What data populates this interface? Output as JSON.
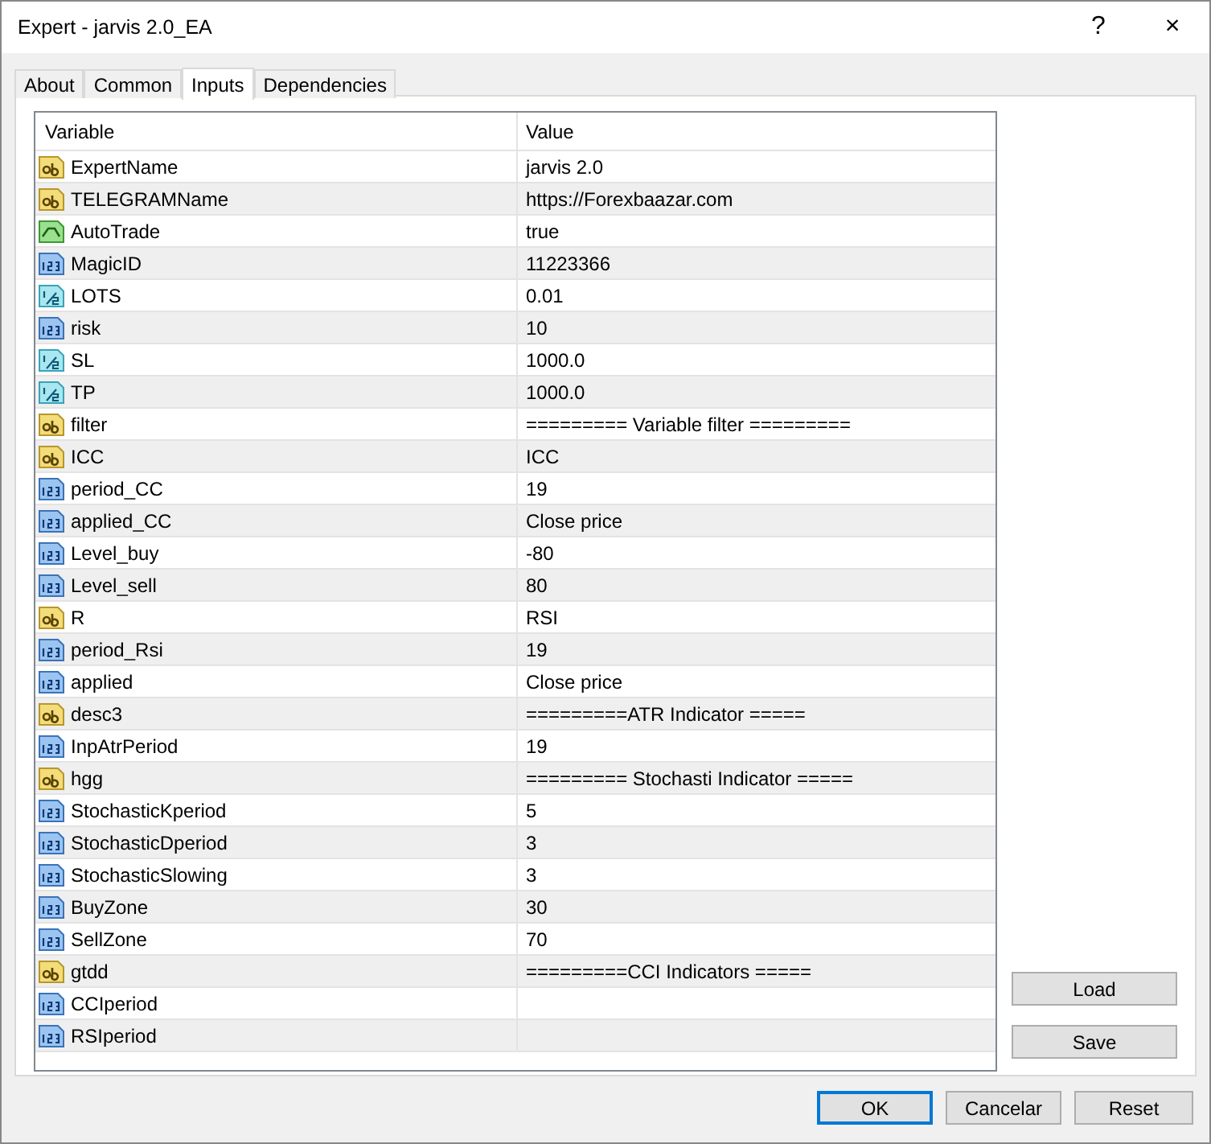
{
  "window": {
    "title": "Expert - jarvis 2.0_EA",
    "help": "?",
    "close": "×"
  },
  "tabs": [
    {
      "label": "About",
      "selected": false
    },
    {
      "label": "Common",
      "selected": false
    },
    {
      "label": "Inputs",
      "selected": true
    },
    {
      "label": "Dependencies",
      "selected": false
    }
  ],
  "table": {
    "columns": [
      "Variable",
      "Value"
    ],
    "rows": [
      {
        "kind": "string",
        "variable": "ExpertName",
        "value": "jarvis 2.0"
      },
      {
        "kind": "string",
        "variable": "TELEGRAMName",
        "value": "https://Forexbaazar.com"
      },
      {
        "kind": "bool",
        "variable": "AutoTrade",
        "value": "true"
      },
      {
        "kind": "int",
        "variable": "MagicID",
        "value": "11223366"
      },
      {
        "kind": "double",
        "variable": "LOTS",
        "value": "0.01"
      },
      {
        "kind": "int",
        "variable": "risk",
        "value": "10"
      },
      {
        "kind": "double",
        "variable": "SL",
        "value": "1000.0"
      },
      {
        "kind": "double",
        "variable": "TP",
        "value": "1000.0"
      },
      {
        "kind": "string",
        "variable": "filter",
        "value": "========= Variable filter ========="
      },
      {
        "kind": "string",
        "variable": "ICC",
        "value": "ICC"
      },
      {
        "kind": "int",
        "variable": "period_CC",
        "value": "19"
      },
      {
        "kind": "int",
        "variable": "applied_CC",
        "value": "Close price"
      },
      {
        "kind": "int",
        "variable": "Level_buy",
        "value": "-80"
      },
      {
        "kind": "int",
        "variable": "Level_sell",
        "value": "80"
      },
      {
        "kind": "string",
        "variable": "R",
        "value": "RSI"
      },
      {
        "kind": "int",
        "variable": "period_Rsi",
        "value": "19"
      },
      {
        "kind": "int",
        "variable": "applied",
        "value": "Close price"
      },
      {
        "kind": "string",
        "variable": "desc3",
        "value": "=========ATR Indicator ====="
      },
      {
        "kind": "int",
        "variable": "InpAtrPeriod",
        "value": "19"
      },
      {
        "kind": "string",
        "variable": "hgg",
        "value": "========= Stochasti Indicator ====="
      },
      {
        "kind": "int",
        "variable": "StochasticKperiod",
        "value": "5"
      },
      {
        "kind": "int",
        "variable": "StochasticDperiod",
        "value": "3"
      },
      {
        "kind": "int",
        "variable": "StochasticSlowing",
        "value": "3"
      },
      {
        "kind": "int",
        "variable": "BuyZone",
        "value": "30"
      },
      {
        "kind": "int",
        "variable": "SellZone",
        "value": "70"
      },
      {
        "kind": "string",
        "variable": "gtdd",
        "value": "=========CCI Indicators ====="
      },
      {
        "kind": "int",
        "variable": "CCIperiod"
      },
      {
        "kind": "int",
        "variable": "RSIperiod"
      }
    ]
  },
  "side_buttons": [
    "Load",
    "Save"
  ],
  "buttons": [
    {
      "label": "OK",
      "default": true
    },
    {
      "label": "Cancelar",
      "default": false
    },
    {
      "label": "Reset",
      "default": false
    }
  ]
}
